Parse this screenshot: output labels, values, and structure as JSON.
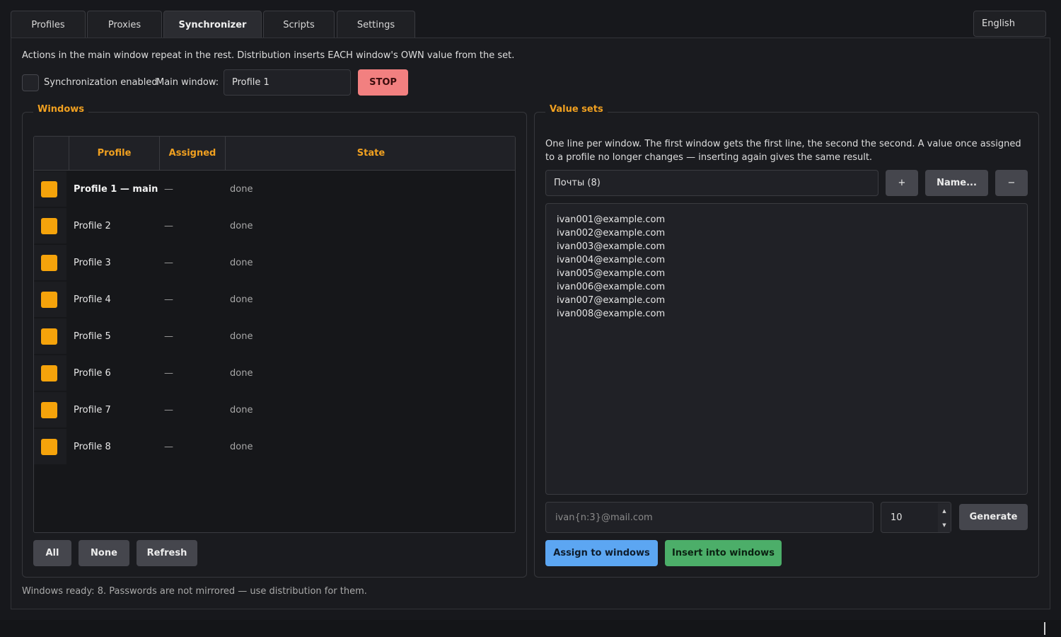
{
  "tabs": [
    "Profiles",
    "Proxies",
    "Synchronizer",
    "Scripts",
    "Settings"
  ],
  "language": "English",
  "info_text": "Actions in the main window repeat in the rest. Distribution inserts EACH window's OWN value from the set.",
  "sync": {
    "checkbox_label": "Synchronization enabled",
    "enabled": false,
    "main_window_label": "Main window:",
    "main_window_value": "Profile 1",
    "stop_label": "STOP"
  },
  "windows": {
    "title": "Windows",
    "headers": {
      "profile": "Profile",
      "assigned": "Assigned",
      "state": "State"
    },
    "rows": [
      {
        "name": "Profile 1  — main",
        "assigned": "—",
        "state": "done",
        "checked": true
      },
      {
        "name": "Profile 2",
        "assigned": "—",
        "state": "done",
        "checked": true
      },
      {
        "name": "Profile 3",
        "assigned": "—",
        "state": "done",
        "checked": true
      },
      {
        "name": "Profile 4",
        "assigned": "—",
        "state": "done",
        "checked": true
      },
      {
        "name": "Profile 5",
        "assigned": "—",
        "state": "done",
        "checked": true
      },
      {
        "name": "Profile 6",
        "assigned": "—",
        "state": "done",
        "checked": true
      },
      {
        "name": "Profile 7",
        "assigned": "—",
        "state": "done",
        "checked": true
      },
      {
        "name": "Profile 8",
        "assigned": "—",
        "state": "done",
        "checked": true
      }
    ],
    "buttons": {
      "all": "All",
      "none": "None",
      "refresh": "Refresh"
    }
  },
  "value_sets": {
    "title": "Value sets",
    "description": "One line per window. The first window gets the first line, the second the second. A value once assigned to a profile no longer changes — inserting again gives the same result.",
    "selected_set": "Почты (8)",
    "add_label": "+",
    "rename_label": "Name...",
    "remove_label": "−",
    "values": [
      "ivan001@example.com",
      "ivan002@example.com",
      "ivan003@example.com",
      "ivan004@example.com",
      "ivan005@example.com",
      "ivan006@example.com",
      "ivan007@example.com",
      "ivan008@example.com"
    ],
    "pattern_placeholder": "ivan{n:3}@mail.com",
    "count": "10",
    "generate_label": "Generate",
    "assign_label": "Assign to windows",
    "insert_label": "Insert into windows"
  },
  "status_text": "Windows ready: 8. Passwords are not mirrored — use distribution for them.",
  "colors": {
    "accent": "#f0a020",
    "stop": "#f28080",
    "assign": "#5ca6f2",
    "insert": "#4cae69",
    "checkbox": "#f5a30b"
  }
}
